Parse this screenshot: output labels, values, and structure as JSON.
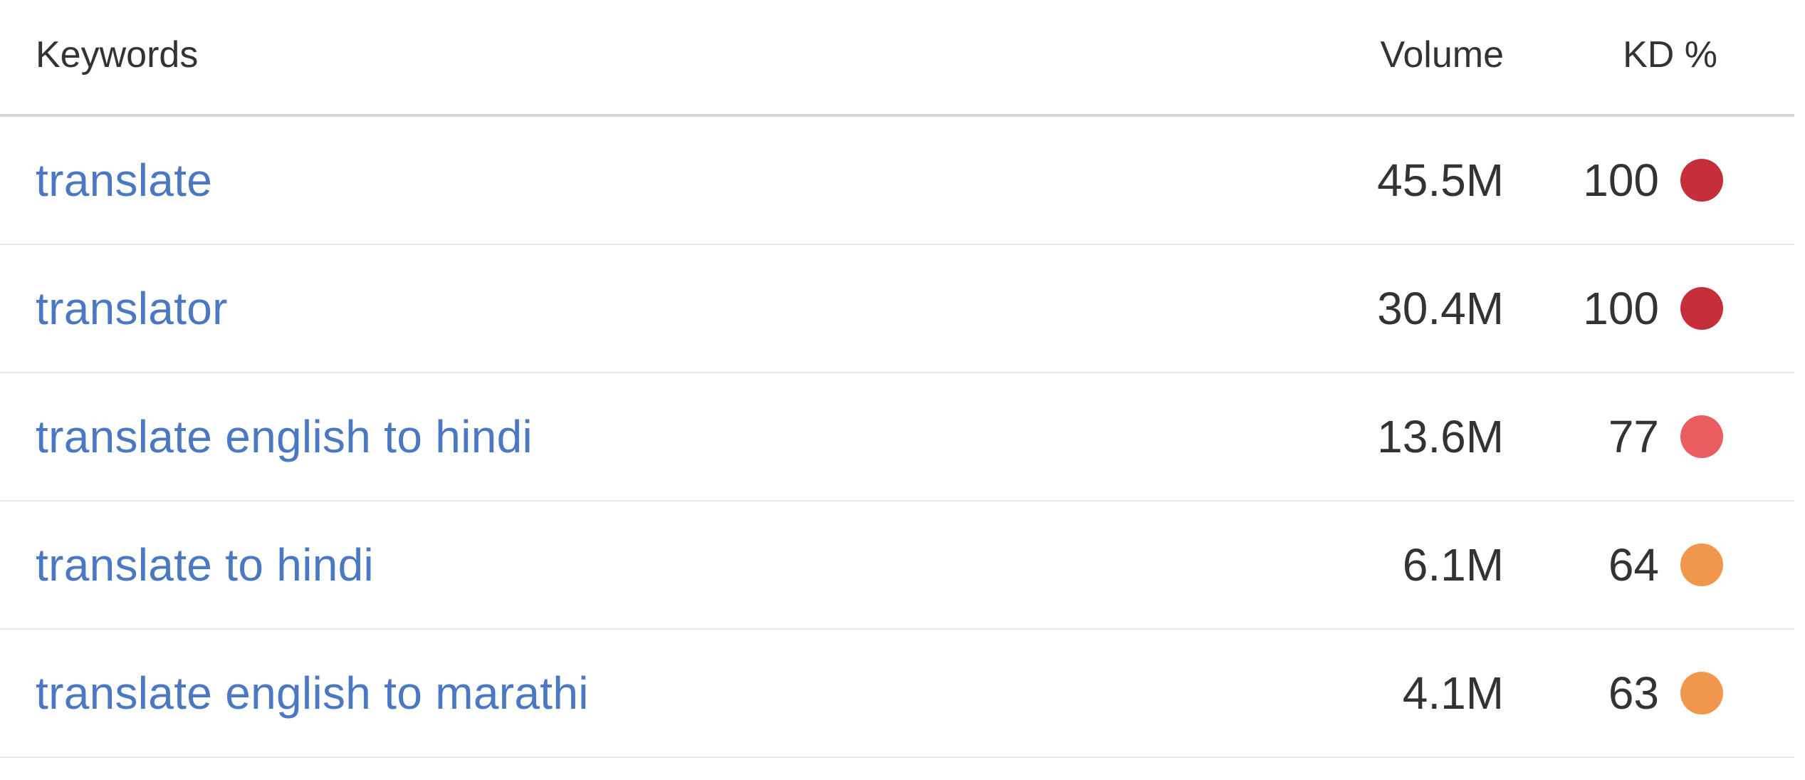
{
  "header": {
    "keywords": "Keywords",
    "volume": "Volume",
    "kd": "KD %"
  },
  "rows": [
    {
      "keyword": "translate",
      "volume": "45.5M",
      "kd": "100",
      "kd_color": "#c62f3a"
    },
    {
      "keyword": "translator",
      "volume": "30.4M",
      "kd": "100",
      "kd_color": "#c62f3a"
    },
    {
      "keyword": "translate english to hindi",
      "volume": "13.6M",
      "kd": "77",
      "kd_color": "#ea5c5f"
    },
    {
      "keyword": "translate to hindi",
      "volume": "6.1M",
      "kd": "64",
      "kd_color": "#f0974d"
    },
    {
      "keyword": "translate english to marathi",
      "volume": "4.1M",
      "kd": "63",
      "kd_color": "#f0974d"
    }
  ]
}
